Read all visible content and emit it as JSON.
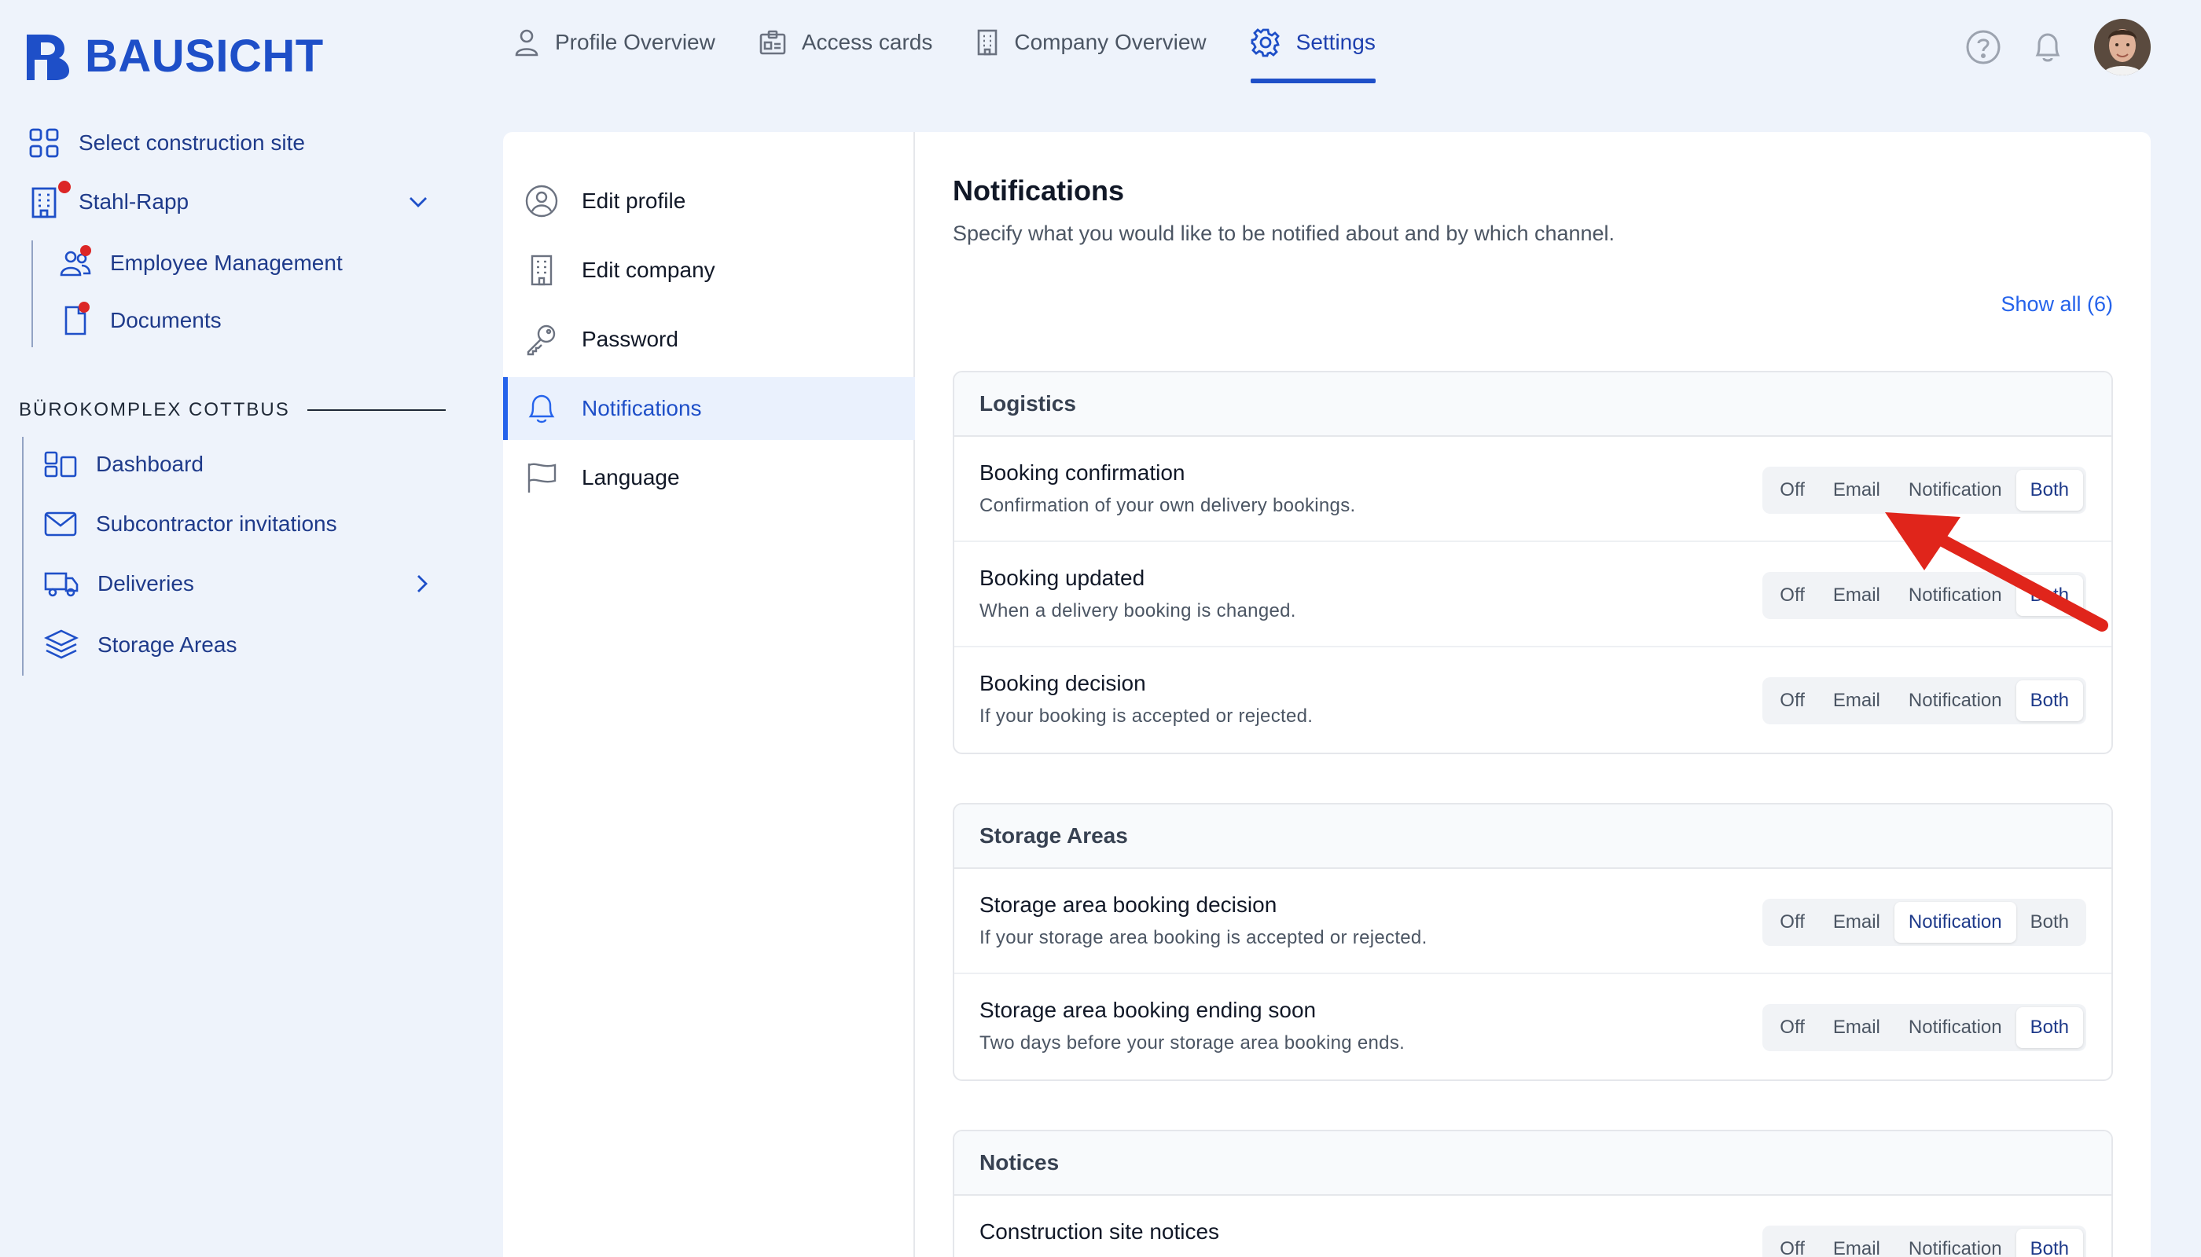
{
  "brand": {
    "name": "BAUSICHT",
    "color": "#1e4fc8"
  },
  "topnav": [
    {
      "label": "Profile Overview",
      "icon": "user-icon"
    },
    {
      "label": "Access cards",
      "icon": "id-card-icon"
    },
    {
      "label": "Company Overview",
      "icon": "building-icon"
    },
    {
      "label": "Settings",
      "icon": "gear-icon",
      "active": true
    }
  ],
  "header_icons": [
    "help-icon",
    "bell-icon",
    "avatar"
  ],
  "sidebar": {
    "select_site": "Select construction site",
    "company": "Stahl-Rapp",
    "company_items": [
      "Employee Management",
      "Documents"
    ],
    "section_title": "BÜROKOMPLEX COTTBUS",
    "site_items": [
      "Dashboard",
      "Subcontractor invitations",
      "Deliveries",
      "Storage Areas"
    ]
  },
  "settings_nav": [
    "Edit profile",
    "Edit company",
    "Password",
    "Notifications",
    "Language"
  ],
  "notifications": {
    "title": "Notifications",
    "lead": "Specify what you would like to be notified about and by which channel.",
    "show_all": "Show all (6)",
    "options": [
      "Off",
      "Email",
      "Notification",
      "Both"
    ],
    "groups": [
      {
        "title": "Logistics",
        "rows": [
          {
            "title": "Booking confirmation",
            "desc": "Confirmation of your own delivery bookings.",
            "selected": "Both"
          },
          {
            "title": "Booking updated",
            "desc": "When a delivery booking is changed.",
            "selected": "Both"
          },
          {
            "title": "Booking decision",
            "desc": "If your booking is accepted or rejected.",
            "selected": "Both"
          }
        ]
      },
      {
        "title": "Storage Areas",
        "rows": [
          {
            "title": "Storage area booking decision",
            "desc": "If your storage area booking is accepted or rejected.",
            "selected": "Notification"
          },
          {
            "title": "Storage area booking ending soon",
            "desc": "Two days before your storage area booking ends.",
            "selected": "Both"
          }
        ]
      },
      {
        "title": "Notices",
        "rows": [
          {
            "title": "Construction site notices",
            "desc": "",
            "selected": "Both"
          }
        ]
      }
    ]
  },
  "annotation": {
    "type": "arrow",
    "color": "#e0251b"
  }
}
